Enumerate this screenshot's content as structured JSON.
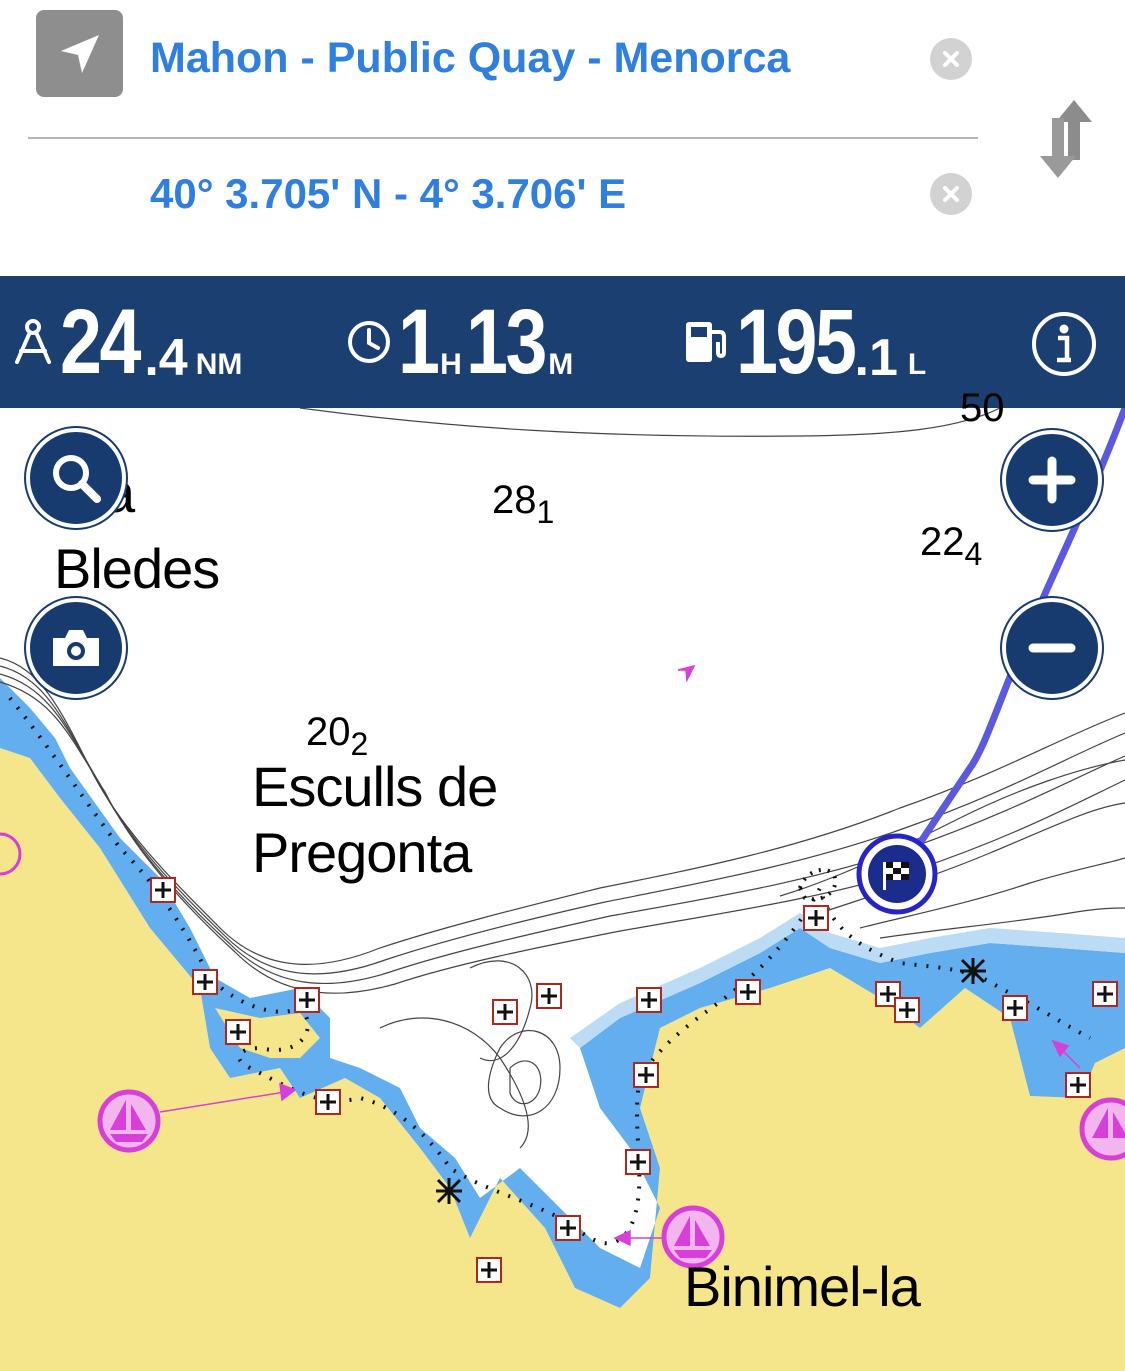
{
  "route": {
    "destination": "Mahon - Public Quay - Menorca",
    "coordinates": "40° 3.705' N - 4° 3.706' E"
  },
  "stats": {
    "distance": {
      "whole": "24",
      "fraction": ".4",
      "unit": "NM"
    },
    "time": {
      "hours": "1",
      "hours_unit": "H",
      "minutes": "13",
      "minutes_unit": "M"
    },
    "fuel": {
      "whole": "195",
      "fraction": ".1",
      "unit": "L"
    }
  },
  "map": {
    "places": {
      "partial_label": "a",
      "bledes": "Bledes",
      "escull_line1": "Esculls de",
      "escull_line2": "Pregonta",
      "binimel": "Binimel-la"
    },
    "soundings": [
      {
        "main": "28",
        "sub": "1"
      },
      {
        "main": "22",
        "sub": "4"
      },
      {
        "main": "20",
        "sub": "2"
      },
      {
        "main": "50",
        "sub": ""
      }
    ]
  },
  "colors": {
    "header_text": "#2f7fe0",
    "stats_bar": "#1c3f72",
    "land": "#f5e68c",
    "shallow_water": "#63aeee",
    "route_line": "#5a5ae0",
    "marina_marker": "#d83fd8"
  },
  "icons": {
    "nav": "location-arrow-icon",
    "clear": "clear-x-icon",
    "swap": "swap-arrows-icon",
    "distance": "compass-icon",
    "time": "clock-icon",
    "fuel": "fuel-pump-icon",
    "info": "info-icon",
    "search": "search-icon",
    "camera": "camera-icon",
    "zoom_in": "plus-icon",
    "zoom_out": "minus-icon",
    "destination": "checkered-flag-icon",
    "marina": "sailboat-icon"
  }
}
